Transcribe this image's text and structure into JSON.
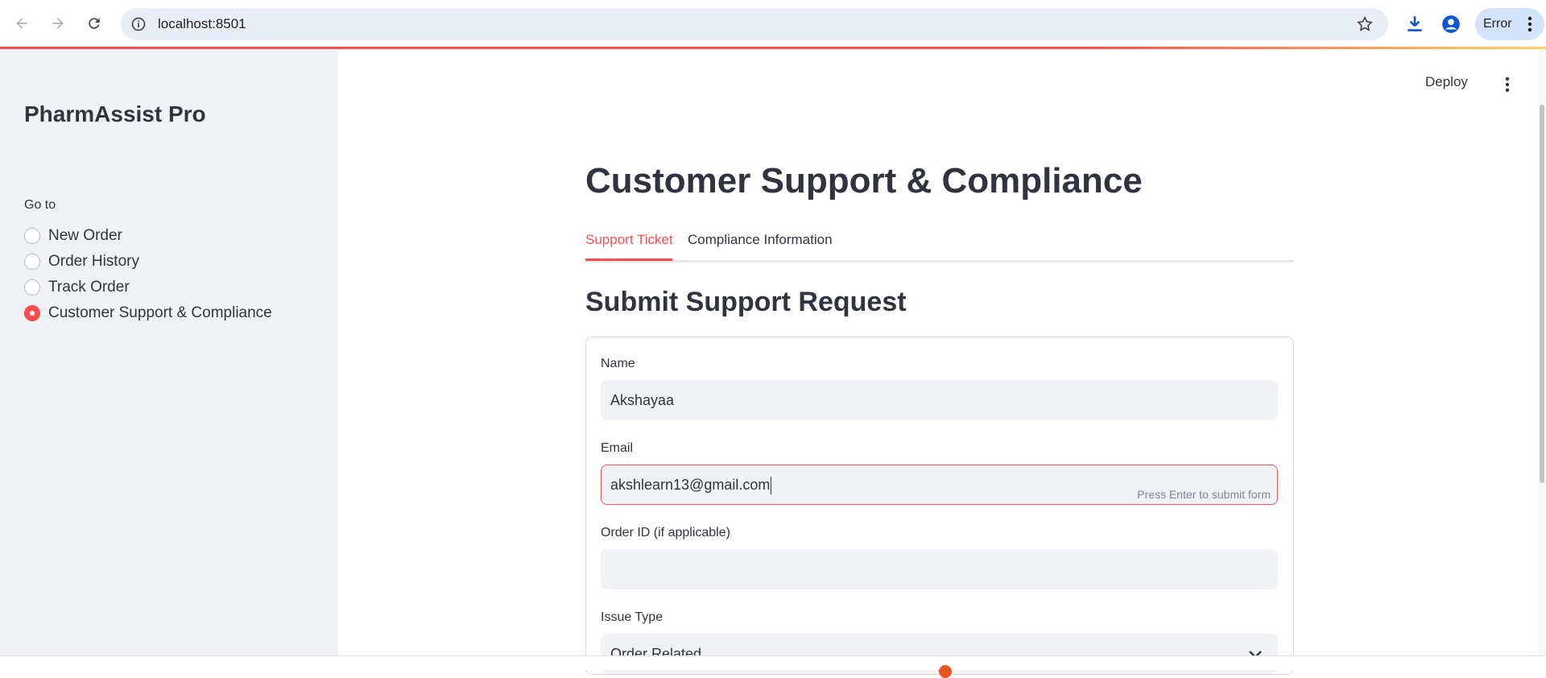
{
  "browser": {
    "url": "localhost:8501",
    "error_label": "Error"
  },
  "sidebar": {
    "title": "PharmAssist Pro",
    "nav_label": "Go to",
    "items": [
      {
        "label": "New Order",
        "selected": false
      },
      {
        "label": "Order History",
        "selected": false
      },
      {
        "label": "Track Order",
        "selected": false
      },
      {
        "label": "Customer Support & Compliance",
        "selected": true
      }
    ]
  },
  "header": {
    "deploy_label": "Deploy"
  },
  "main": {
    "title": "Customer Support & Compliance",
    "tabs": [
      {
        "label": "Support Ticket",
        "active": true
      },
      {
        "label": "Compliance Information",
        "active": false
      }
    ],
    "section_title": "Submit Support Request",
    "form": {
      "name_label": "Name",
      "name_value": "Akshayaa",
      "email_label": "Email",
      "email_value": "akshlearn13@gmail.com",
      "email_hint": "Press Enter to submit form",
      "order_id_label": "Order ID (if applicable)",
      "order_id_value": "",
      "issue_type_label": "Issue Type",
      "issue_type_value": "Order Related"
    }
  },
  "colors": {
    "accent": "#ff4b4b",
    "sidebar_bg": "#f0f2f6",
    "text": "#31333f",
    "input_bg": "#f0f2f6"
  }
}
